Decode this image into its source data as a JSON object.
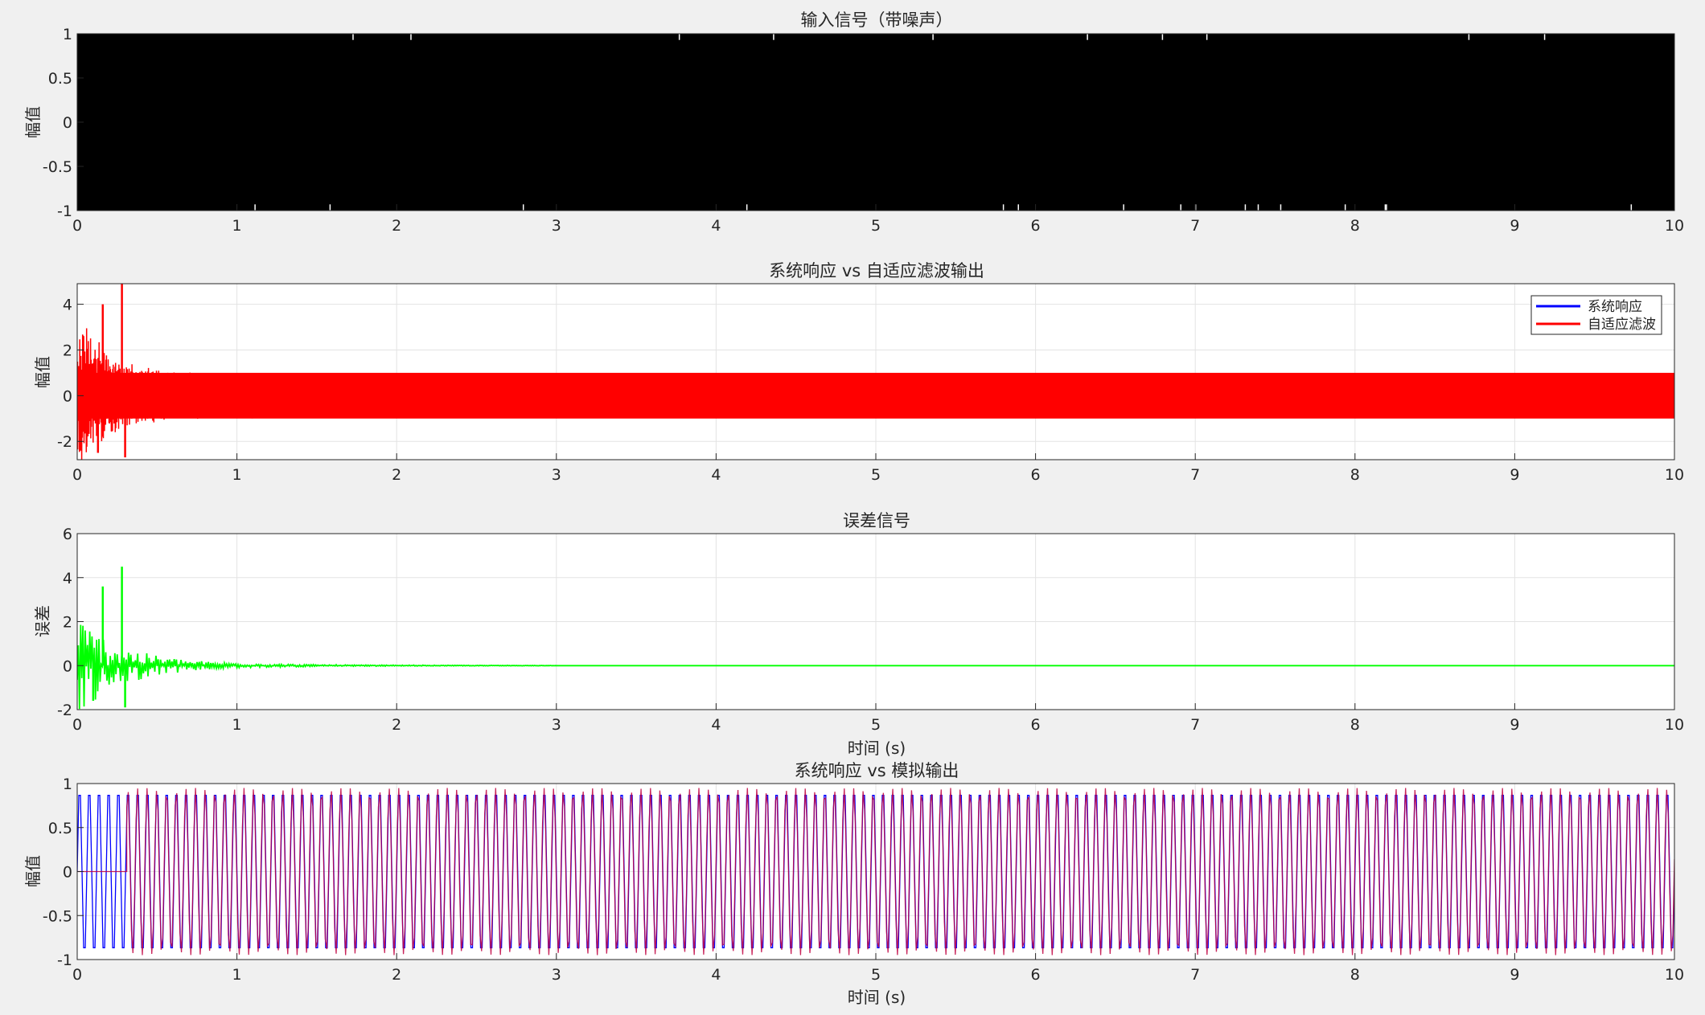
{
  "chart_data": [
    {
      "type": "line",
      "title": "输入信号（带噪声）",
      "xlabel": "",
      "ylabel": "幅值",
      "xlim": [
        0,
        10
      ],
      "ylim": [
        -1,
        1
      ],
      "xticks": [
        "0",
        "1",
        "2",
        "3",
        "4",
        "5",
        "6",
        "7",
        "8",
        "9",
        "10"
      ],
      "yticks": [
        "-1",
        "-0.5",
        "0",
        "0.5",
        "1"
      ],
      "grid": true,
      "series": [
        {
          "color": "#000000",
          "description_values": {
            "min": -1,
            "max": 1,
            "fills_full_range": true
          }
        }
      ]
    },
    {
      "type": "line",
      "title": "系统响应 vs 自适应滤波输出",
      "xlabel": "",
      "ylabel": "幅值",
      "xlim": [
        0,
        10
      ],
      "ylim": [
        -2.8,
        4.9
      ],
      "xticks": [
        "0",
        "1",
        "2",
        "3",
        "4",
        "5",
        "6",
        "7",
        "8",
        "9",
        "10"
      ],
      "yticks": [
        "-2",
        "0",
        "2",
        "4"
      ],
      "grid": true,
      "legend_position": "top-right",
      "series": [
        {
          "name": "系统响应",
          "color": "#0000ff",
          "amplitude": 1
        },
        {
          "name": "自适应滤波",
          "color": "#ff0000",
          "amplitude": 1,
          "transient_peaks": [
            [
              0.16,
              4.0
            ],
            [
              0.28,
              4.9
            ],
            [
              0.3,
              -2.7
            ],
            [
              0.13,
              -2.5
            ]
          ]
        }
      ]
    },
    {
      "type": "line",
      "title": "误差信号",
      "xlabel": "时间 (s)",
      "ylabel": "误差",
      "xlim": [
        0,
        10
      ],
      "ylim": [
        -2,
        6
      ],
      "xticks": [
        "0",
        "1",
        "2",
        "3",
        "4",
        "5",
        "6",
        "7",
        "8",
        "9",
        "10"
      ],
      "yticks": [
        "-2",
        "0",
        "2",
        "4",
        "6"
      ],
      "grid": true,
      "series": [
        {
          "color": "#00ff00",
          "transient_peaks": [
            [
              0.16,
              3.6
            ],
            [
              0.28,
              4.5
            ],
            [
              0.3,
              -1.9
            ],
            [
              0.1,
              -1.6
            ]
          ],
          "steady_value": 0
        }
      ]
    },
    {
      "type": "line",
      "title": "系统响应 vs 模拟输出",
      "xlabel": "时间 (s)",
      "ylabel": "幅值",
      "xlim": [
        0,
        10
      ],
      "ylim": [
        -1,
        1
      ],
      "xticks": [
        "0",
        "1",
        "2",
        "3",
        "4",
        "5",
        "6",
        "7",
        "8",
        "9",
        "10"
      ],
      "yticks": [
        "-1",
        "-0.5",
        "0",
        "0.5",
        "1"
      ],
      "grid": true,
      "series": [
        {
          "color": "#0000ff",
          "amplitude": 1,
          "cycles_visible": 165
        },
        {
          "color": "#c00040",
          "amplitude": 0.95,
          "start_x": 0.31,
          "cycles_visible": 145
        }
      ]
    }
  ]
}
